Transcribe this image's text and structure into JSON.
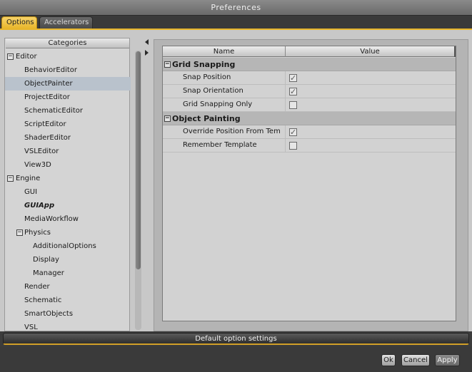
{
  "window": {
    "title": "Preferences"
  },
  "tabs": [
    {
      "label": "Options",
      "active": true
    },
    {
      "label": "Accelerators",
      "active": false
    }
  ],
  "categories": {
    "header": "Categories",
    "items": [
      {
        "label": "Editor",
        "level": 0,
        "expander": "−"
      },
      {
        "label": "BehaviorEditor",
        "level": 1
      },
      {
        "label": "ObjectPainter",
        "level": 1,
        "selected": true
      },
      {
        "label": "ProjectEditor",
        "level": 1
      },
      {
        "label": "SchematicEditor",
        "level": 1
      },
      {
        "label": "ScriptEditor",
        "level": 1
      },
      {
        "label": "ShaderEditor",
        "level": 1
      },
      {
        "label": "VSLEditor",
        "level": 1
      },
      {
        "label": "View3D",
        "level": 1
      },
      {
        "label": "Engine",
        "level": 0,
        "expander": "−"
      },
      {
        "label": "GUI",
        "level": 1
      },
      {
        "label": "GUIApp",
        "level": 1,
        "emphasis": true
      },
      {
        "label": "MediaWorkflow",
        "level": 1
      },
      {
        "label": "Physics",
        "level": 1,
        "expander": "−"
      },
      {
        "label": "AdditionalOptions",
        "level": 2
      },
      {
        "label": "Display",
        "level": 2
      },
      {
        "label": "Manager",
        "level": 2
      },
      {
        "label": "Render",
        "level": 1
      },
      {
        "label": "Schematic",
        "level": 1
      },
      {
        "label": "SmartObjects",
        "level": 1
      },
      {
        "label": "VSL",
        "level": 1
      }
    ]
  },
  "properties": {
    "columns": {
      "name": "Name",
      "value": "Value"
    },
    "groups": [
      {
        "label": "Grid Snapping",
        "expander": "−",
        "rows": [
          {
            "name": "Snap Position",
            "checked": true
          },
          {
            "name": "Snap Orientation",
            "checked": true
          },
          {
            "name": "Grid Snapping Only",
            "checked": false
          }
        ]
      },
      {
        "label": "Object Painting",
        "expander": "−",
        "rows": [
          {
            "name": "Override Position From Template",
            "checked": true
          },
          {
            "name": "Remember Template",
            "checked": false
          }
        ]
      }
    ]
  },
  "default_bar": {
    "label": "Default option settings"
  },
  "footer": {
    "ok_label": "Ok",
    "cancel_label": "Cancel",
    "apply_label": "Apply"
  },
  "colors": {
    "accent": "#e8b62b",
    "selection": "#b9c2cc"
  }
}
